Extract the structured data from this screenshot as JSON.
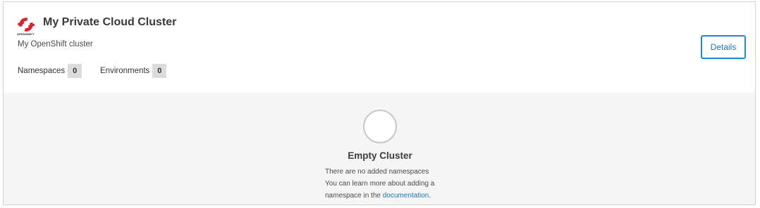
{
  "cluster": {
    "logo_text": "OPENSHIFT",
    "title": "My Private Cloud Cluster",
    "description": "My OpenShift cluster",
    "stats": [
      {
        "label": "Namespaces",
        "count": "0"
      },
      {
        "label": "Environments",
        "count": "0"
      }
    ],
    "details_label": "Details"
  },
  "empty_state": {
    "title": "Empty Cluster",
    "line1": "There are no added namespaces",
    "line2": "You can learn more about adding a",
    "line3_prefix": "namespace in the ",
    "link_text": "documentation",
    "line3_suffix": "."
  },
  "colors": {
    "accent": "#1b8bc9",
    "openshift_red": "#db212e",
    "empty_background": "#f5f5f5"
  }
}
